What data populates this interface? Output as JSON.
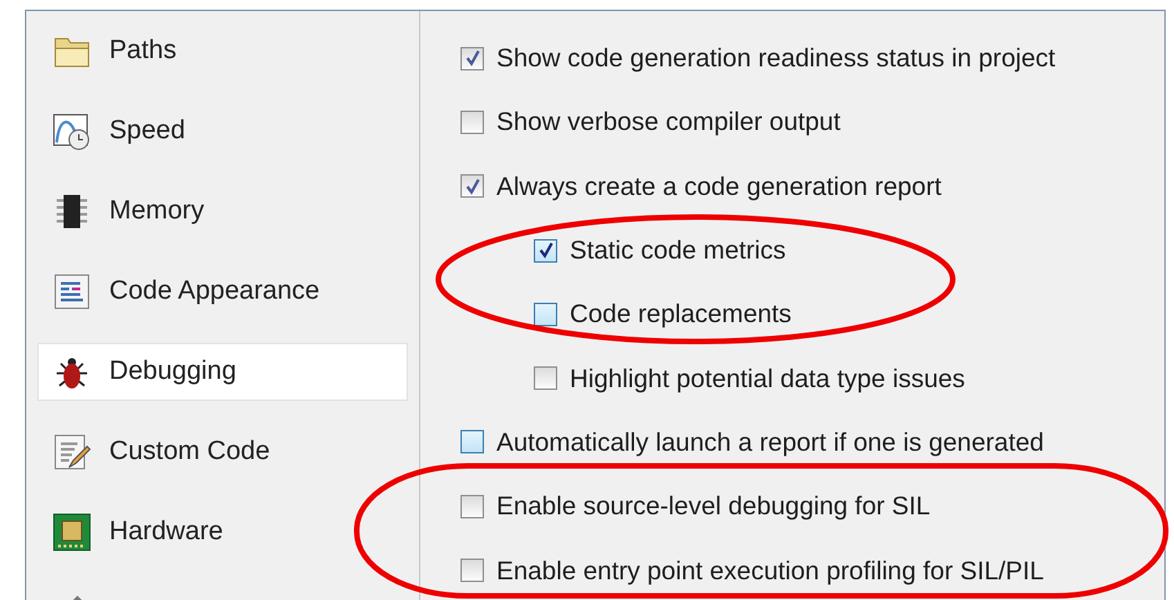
{
  "sidebar": {
    "items": [
      {
        "label": "Paths",
        "selected": false
      },
      {
        "label": "Speed",
        "selected": false
      },
      {
        "label": "Memory",
        "selected": false
      },
      {
        "label": "Code Appearance",
        "selected": false
      },
      {
        "label": "Debugging",
        "selected": true
      },
      {
        "label": "Custom Code",
        "selected": false
      },
      {
        "label": "Hardware",
        "selected": false
      },
      {
        "selected": false
      }
    ]
  },
  "options": [
    {
      "label": "Show code generation readiness status in project",
      "checked": true,
      "kind": "standard"
    },
    {
      "label": "Show verbose compiler output",
      "checked": false,
      "kind": "standard"
    },
    {
      "label": "Always create a code generation report",
      "checked": true,
      "kind": "standard",
      "children": [
        {
          "label": "Static code metrics",
          "checked": true,
          "kind": "highlighted"
        },
        {
          "label": "Code replacements",
          "checked": false,
          "kind": "highlighted"
        },
        {
          "label": "Highlight potential data type issues",
          "checked": false,
          "kind": "standard"
        }
      ]
    },
    {
      "label": "Automatically launch a report if one is generated",
      "checked": false,
      "kind": "highlighted"
    },
    {
      "label": "Enable source-level debugging for SIL",
      "checked": false,
      "kind": "standard"
    },
    {
      "label": "Enable entry point execution profiling for SIL/PIL",
      "checked": false,
      "kind": "standard"
    }
  ]
}
